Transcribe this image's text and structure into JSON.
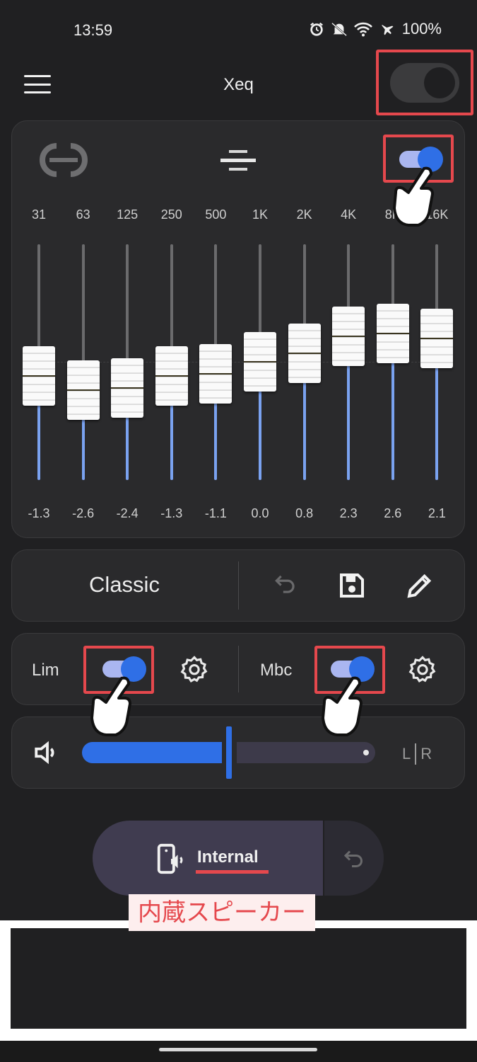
{
  "status_bar": {
    "time": "13:59",
    "battery": "100%"
  },
  "app_bar": {
    "title": "Xeq"
  },
  "equalizer": {
    "bands": [
      {
        "freq": "31",
        "gain": "-1.3",
        "gain_db": -1.3
      },
      {
        "freq": "63",
        "gain": "-2.6",
        "gain_db": -2.6
      },
      {
        "freq": "125",
        "gain": "-2.4",
        "gain_db": -2.4
      },
      {
        "freq": "250",
        "gain": "-1.3",
        "gain_db": -1.3
      },
      {
        "freq": "500",
        "gain": "-1.1",
        "gain_db": -1.1
      },
      {
        "freq": "1K",
        "gain": "0.0",
        "gain_db": 0.0
      },
      {
        "freq": "2K",
        "gain": "0.8",
        "gain_db": 0.8
      },
      {
        "freq": "4K",
        "gain": "2.3",
        "gain_db": 2.3
      },
      {
        "freq": "8K",
        "gain": "2.6",
        "gain_db": 2.6
      },
      {
        "freq": "16K",
        "gain": "2.1",
        "gain_db": 2.1
      }
    ]
  },
  "preset": {
    "name": "Classic"
  },
  "effects": {
    "lim_label": "Lim",
    "mbc_label": "Mbc"
  },
  "volume": {
    "balance_label_left": "L",
    "balance_label_right": "R"
  },
  "output": {
    "label": "Internal",
    "annotation": "内蔵スピーカー"
  },
  "colors": {
    "accent": "#2f6fe6",
    "annotation_red": "#e5484d",
    "background": "#202022"
  }
}
